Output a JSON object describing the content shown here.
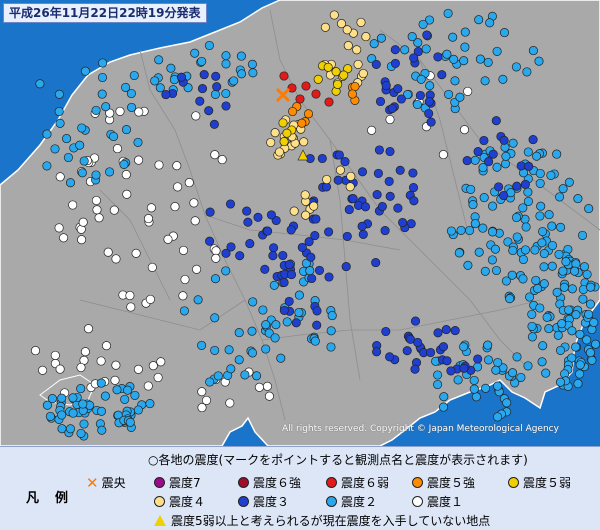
{
  "title": "平成26年11月22日22時19分発表",
  "copyright": "All rights reserved. Copyright © Japan Meteorological Agency",
  "legend": {
    "label": "凡例",
    "head": "○各地の震度(マークをポイントすると観測点名と震度が表示されます)",
    "epicenter": "震央",
    "items": [
      {
        "label": "震度7",
        "color": "#9b0a8c"
      },
      {
        "label": "震度６強",
        "color": "#9e0c2c"
      },
      {
        "label": "震度６弱",
        "color": "#e11a1a"
      },
      {
        "label": "震度５強",
        "color": "#ff8c00"
      },
      {
        "label": "震度５弱",
        "color": "#f0d000"
      },
      {
        "label": "震度４",
        "color": "#ffe08a"
      },
      {
        "label": "震度３",
        "color": "#1f3fd0"
      },
      {
        "label": "震度２",
        "color": "#29a8ee"
      },
      {
        "label": "震度１",
        "color": "#ffffff"
      }
    ],
    "unknown_note": "震度5弱以上と考えられるが現在震度を入手していない地点"
  },
  "colors": {
    "sea": "#1a74c9",
    "land": "#a9a9a9",
    "coast": "#ffffff",
    "border": "#8e8e8e",
    "epicenter": "#ff7a00"
  }
}
